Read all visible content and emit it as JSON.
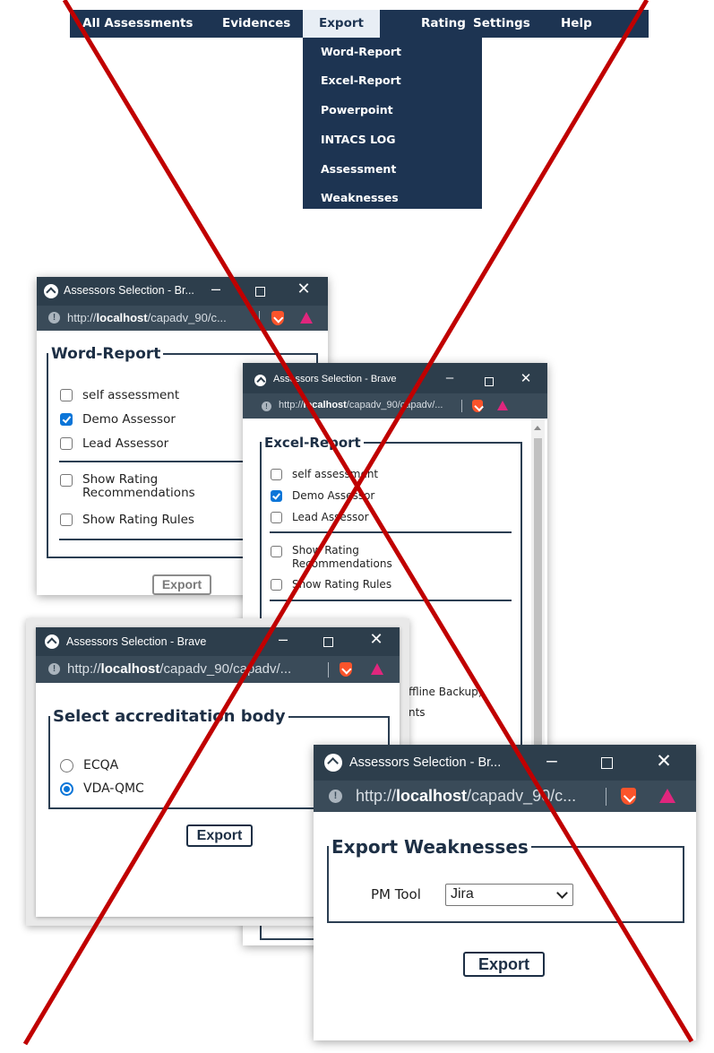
{
  "menu": {
    "items": [
      "All Assessments",
      "Evidences",
      "Export",
      "Rating",
      "Settings",
      "Help"
    ],
    "active": "Export",
    "export_submenu": [
      "Word-Report",
      "Excel-Report",
      "Powerpoint",
      "INTACS LOG",
      "Assessment",
      "Weaknesses"
    ]
  },
  "windows": {
    "word": {
      "title": "Assessors Selection - Br...",
      "url_prefix": "http://",
      "url_host": "localhost",
      "url_rest": "/capadv_90/c...",
      "legend": "Word-Report",
      "options": [
        {
          "label": "self assessment",
          "checked": false
        },
        {
          "label": "Demo Assessor",
          "checked": true
        },
        {
          "label": "Lead Assessor",
          "checked": false
        }
      ],
      "show_rating_recommendations": "Show Rating Recommendations",
      "show_rating_rules": "Show Rating Rules",
      "export": "Export"
    },
    "excel": {
      "title": "Assessors Selection - Brave",
      "url_prefix": "http://",
      "url_host": "localhost",
      "url_rest": "/capadv_90/capadv/...",
      "legend": "Excel-Report",
      "options": [
        {
          "label": "self assessment",
          "checked": false
        },
        {
          "label": "Demo Assessor",
          "checked": true
        },
        {
          "label": "Lead Assessor",
          "checked": false
        }
      ],
      "show_rating_recommendations": "Show Rating Recommendations",
      "show_rating_rules": "Show Rating Rules",
      "partial_offline_backup": "ffline Backup)",
      "partial_nts": "nts"
    },
    "accreditation": {
      "title": "Assessors Selection - Brave",
      "url_prefix": "http://",
      "url_host": "localhost",
      "url_rest": "/capadv_90/capadv/...",
      "legend": "Select accreditation body",
      "options": [
        {
          "label": "ECQA",
          "selected": false
        },
        {
          "label": "VDA-QMC",
          "selected": true
        }
      ],
      "export": "Export"
    },
    "weaknesses": {
      "title": "Assessors Selection - Br...",
      "url_prefix": "http://",
      "url_host": "localhost",
      "url_rest": "/capadv_90/c...",
      "legend": "Export Weaknesses",
      "pm_tool_label": "PM Tool",
      "pm_tool_value": "Jira",
      "export": "Export"
    }
  },
  "colors": {
    "menu_bg": "#1d3452",
    "titlebar": "#2d3e4c",
    "cross": "#c00000",
    "checkbox_on": "#0b75d8"
  },
  "icons": [
    "brave-lion-icon",
    "brave-triangle-icon",
    "info-icon",
    "minimize-icon",
    "maximize-icon",
    "close-icon",
    "chevron-down-icon"
  ]
}
